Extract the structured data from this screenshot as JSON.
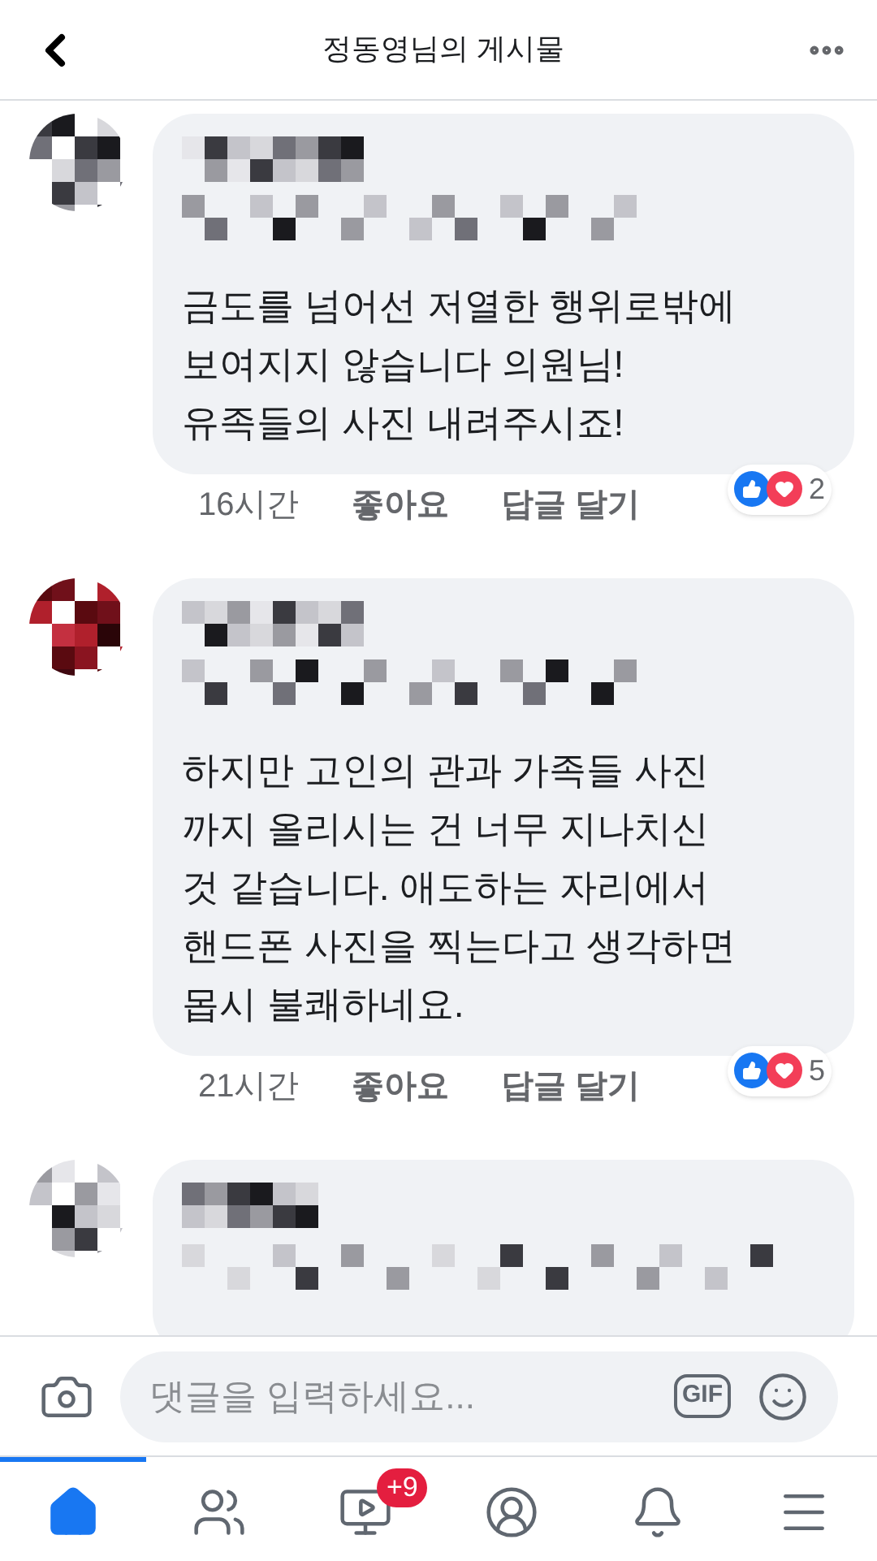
{
  "header": {
    "title": "정동영님의 게시물"
  },
  "comments": [
    {
      "lines": [
        "금도를 넘어선 저열한 행위로밖에",
        "보여지지 않습니다 의원님!",
        "유족들의 사진 내려주시죠!"
      ],
      "time": "16시간",
      "like": "좋아요",
      "reply": "답글 달기",
      "reaction_count": "2"
    },
    {
      "lines": [
        "하지만 고인의 관과 가족들 사진",
        "까지 올리시는 건 너무 지나치신",
        "것 같습니다. 애도하는 자리에서",
        "핸드폰 사진을 찍는다고 생각하면",
        "몹시 불쾌하네요."
      ],
      "time": "21시간",
      "like": "좋아요",
      "reply": "답글 달기",
      "reaction_count": "5"
    }
  ],
  "composer": {
    "placeholder": "댓글을 입력하세요...",
    "gif": "GIF"
  },
  "nav": [
    {
      "kind": "home",
      "selected": true
    },
    {
      "kind": "friends",
      "selected": false
    },
    {
      "kind": "watch",
      "selected": false,
      "badge": "+9"
    },
    {
      "kind": "profile",
      "selected": false
    },
    {
      "kind": "bell",
      "selected": false
    },
    {
      "kind": "menu",
      "selected": false
    }
  ]
}
